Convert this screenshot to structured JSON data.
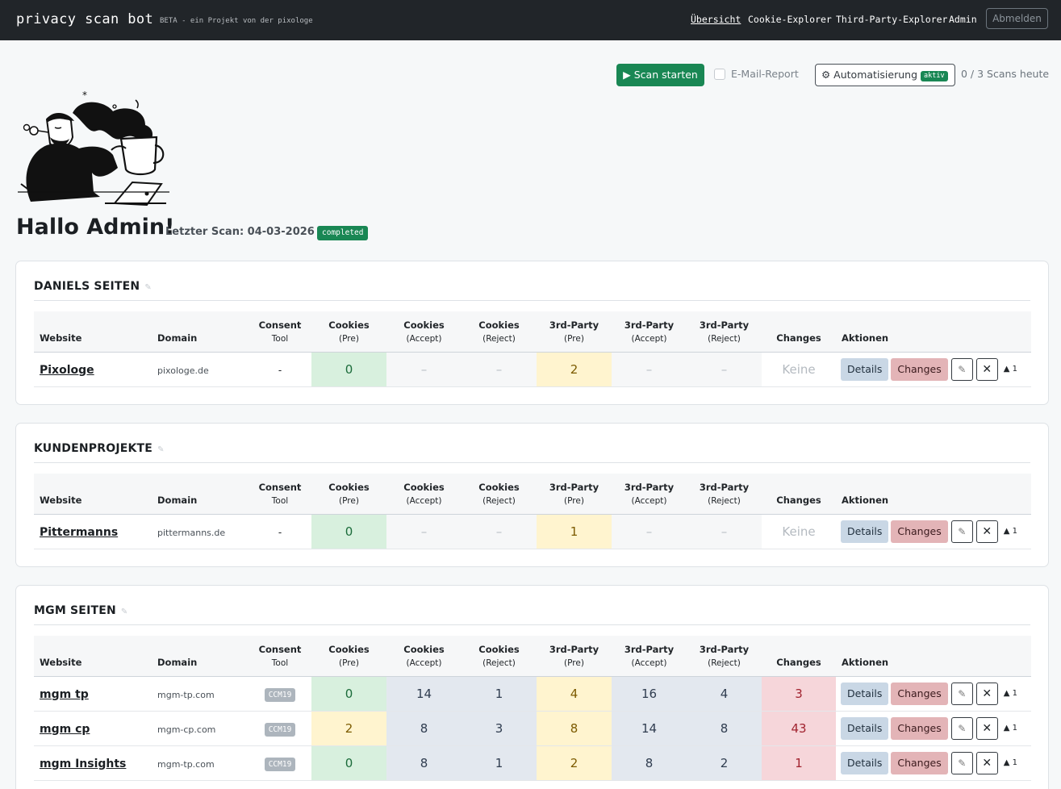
{
  "app": {
    "brand": "privacy scan bot",
    "subtitle": "BETA - ein Projekt von der pixologe",
    "nav": [
      "Übersicht",
      "Cookie-Explorer",
      "Third-Party-Explorer",
      "Admin"
    ],
    "logout": "Abmelden"
  },
  "actions": {
    "scan_button": "▶ Scan starten",
    "email_report": "E-Mail-Report",
    "automation": "⚙ Automatisierung",
    "automation_badge": "aktiv",
    "scans_today": "0 / 3 Scans heute"
  },
  "greeting": {
    "title": "Hallo Admin!",
    "last_scan": "Letzter Scan: 04-03-2026",
    "status": "completed"
  },
  "table_headers": {
    "website": "Website",
    "domain": "Domain",
    "consent": [
      "Consent",
      "Tool"
    ],
    "cookies_pre": [
      "Cookies",
      "(Pre)"
    ],
    "cookies_accept": [
      "Cookies",
      "(Accept)"
    ],
    "cookies_reject": [
      "Cookies",
      "(Reject)"
    ],
    "tp_pre": [
      "3rd-Party",
      "(Pre)"
    ],
    "tp_accept": [
      "3rd-Party",
      "(Accept)"
    ],
    "tp_reject": [
      "3rd-Party",
      "(Reject)"
    ],
    "changes": "Changes",
    "actions": "Aktionen"
  },
  "buttons": {
    "details": "Details",
    "changes": "Changes",
    "edit": "✎",
    "delete": "✕",
    "move_up": "▲ 1"
  },
  "groups": [
    {
      "title": "Daniels Seiten",
      "rows": [
        {
          "website": "Pixologe",
          "domain": "pixologe.de",
          "consent": "-",
          "cookies_pre": "0",
          "cookies_accept": "–",
          "cookies_reject": "–",
          "tp_pre": "2",
          "tp_accept": "–",
          "tp_reject": "–",
          "changes": "Keine"
        }
      ]
    },
    {
      "title": "Kundenprojekte",
      "rows": [
        {
          "website": "Pittermanns",
          "domain": "pittermanns.de",
          "consent": "-",
          "cookies_pre": "0",
          "cookies_accept": "–",
          "cookies_reject": "–",
          "tp_pre": "1",
          "tp_accept": "–",
          "tp_reject": "–",
          "changes": "Keine"
        }
      ]
    },
    {
      "title": "MGM Seiten",
      "rows": [
        {
          "website": "mgm tp",
          "domain": "mgm-tp.com",
          "consent": "CCM19",
          "cookies_pre": "0",
          "cookies_accept": "14",
          "cookies_reject": "1",
          "tp_pre": "4",
          "tp_accept": "16",
          "tp_reject": "4",
          "changes": "3"
        },
        {
          "website": "mgm cp",
          "domain": "mgm-cp.com",
          "consent": "CCM19",
          "cookies_pre": "2",
          "cookies_accept": "8",
          "cookies_reject": "3",
          "tp_pre": "8",
          "tp_accept": "14",
          "tp_reject": "8",
          "changes": "43"
        },
        {
          "website": "mgm Insights",
          "domain": "mgm-tp.com",
          "consent": "CCM19",
          "cookies_pre": "0",
          "cookies_accept": "8",
          "cookies_reject": "1",
          "tp_pre": "2",
          "tp_accept": "8",
          "tp_reject": "2",
          "changes": "1"
        }
      ]
    }
  ]
}
